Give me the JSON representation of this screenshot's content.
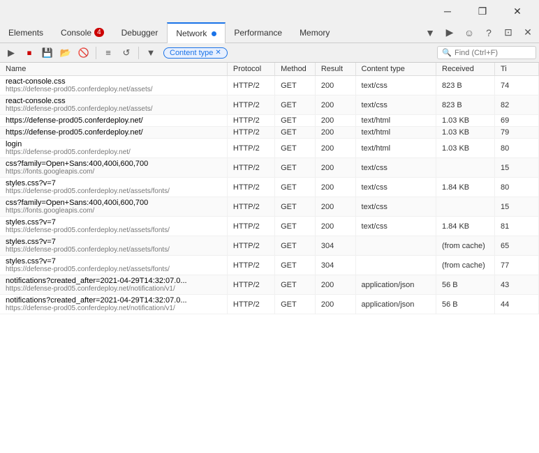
{
  "window": {
    "minimize_label": "─",
    "maximize_label": "❐",
    "close_label": "✕"
  },
  "top_toolbar": {
    "icons": [
      "⬚",
      "☆",
      "⊕",
      "✒",
      "⬆",
      "⋯"
    ]
  },
  "tabs": [
    {
      "id": "elements",
      "label": "Elements",
      "active": false,
      "badge": null,
      "dot": false
    },
    {
      "id": "console",
      "label": "Console",
      "active": false,
      "badge": "4",
      "dot": false
    },
    {
      "id": "debugger",
      "label": "Debugger",
      "active": false,
      "badge": null,
      "dot": false
    },
    {
      "id": "network",
      "label": "Network",
      "active": true,
      "badge": null,
      "dot": true
    },
    {
      "id": "performance",
      "label": "Performance",
      "active": false,
      "badge": null,
      "dot": false
    },
    {
      "id": "memory",
      "label": "Memory",
      "active": false,
      "badge": null,
      "dot": false
    }
  ],
  "tab_bar_right_icons": [
    "▼",
    "▶",
    "☺",
    "?",
    "⊡",
    "✕"
  ],
  "network_toolbar": {
    "buttons": [
      {
        "id": "record",
        "icon": "▶",
        "title": "Record",
        "active": false
      },
      {
        "id": "stop",
        "icon": "⏹",
        "title": "Stop",
        "active": true
      },
      {
        "id": "save",
        "icon": "💾",
        "title": "Save",
        "active": false
      },
      {
        "id": "import",
        "icon": "📥",
        "title": "Import",
        "active": false
      },
      {
        "id": "clear",
        "icon": "🚫",
        "title": "Clear",
        "active": false
      },
      {
        "id": "filter-sep",
        "icon": "sep"
      },
      {
        "id": "har",
        "icon": "📄",
        "title": "HAR",
        "active": false
      },
      {
        "id": "reload",
        "icon": "↺",
        "title": "Reload",
        "active": false
      },
      {
        "id": "filter-sep2",
        "icon": "sep"
      },
      {
        "id": "filter",
        "icon": "▼",
        "title": "Filter",
        "active": false
      }
    ],
    "filter_chip_label": "Content type",
    "search_placeholder": "Find (Ctrl+F)"
  },
  "table": {
    "columns": [
      {
        "id": "name",
        "label": "Name"
      },
      {
        "id": "protocol",
        "label": "Protocol"
      },
      {
        "id": "method",
        "label": "Method"
      },
      {
        "id": "result",
        "label": "Result"
      },
      {
        "id": "content_type",
        "label": "Content type"
      },
      {
        "id": "received",
        "label": "Received"
      },
      {
        "id": "time",
        "label": "Ti"
      }
    ],
    "rows": [
      {
        "name": "react-console.css",
        "url": "https://defense-prod05.conferdeploy.net/assets/",
        "protocol": "HTTP/2",
        "method": "GET",
        "result": "200",
        "content_type": "text/css",
        "received": "823 B",
        "time": "74"
      },
      {
        "name": "react-console.css",
        "url": "https://defense-prod05.conferdeploy.net/assets/",
        "protocol": "HTTP/2",
        "method": "GET",
        "result": "200",
        "content_type": "text/css",
        "received": "823 B",
        "time": "82"
      },
      {
        "name": "https://defense-prod05.conferdeploy.net/",
        "url": "",
        "protocol": "HTTP/2",
        "method": "GET",
        "result": "200",
        "content_type": "text/html",
        "received": "1.03 KB",
        "time": "69"
      },
      {
        "name": "https://defense-prod05.conferdeploy.net/",
        "url": "",
        "protocol": "HTTP/2",
        "method": "GET",
        "result": "200",
        "content_type": "text/html",
        "received": "1.03 KB",
        "time": "79"
      },
      {
        "name": "login",
        "url": "https://defense-prod05.conferdeploy.net/",
        "protocol": "HTTP/2",
        "method": "GET",
        "result": "200",
        "content_type": "text/html",
        "received": "1.03 KB",
        "time": "80"
      },
      {
        "name": "css?family=Open+Sans:400,400i,600,700",
        "url": "https://fonts.googleapis.com/",
        "protocol": "HTTP/2",
        "method": "GET",
        "result": "200",
        "content_type": "text/css",
        "received": "",
        "time": "15"
      },
      {
        "name": "styles.css?v=7",
        "url": "https://defense-prod05.conferdeploy.net/assets/fonts/",
        "protocol": "HTTP/2",
        "method": "GET",
        "result": "200",
        "content_type": "text/css",
        "received": "1.84 KB",
        "time": "80"
      },
      {
        "name": "css?family=Open+Sans:400,400i,600,700",
        "url": "https://fonts.googleapis.com/",
        "protocol": "HTTP/2",
        "method": "GET",
        "result": "200",
        "content_type": "text/css",
        "received": "",
        "time": "15"
      },
      {
        "name": "styles.css?v=7",
        "url": "https://defense-prod05.conferdeploy.net/assets/fonts/",
        "protocol": "HTTP/2",
        "method": "GET",
        "result": "200",
        "content_type": "text/css",
        "received": "1.84 KB",
        "time": "81"
      },
      {
        "name": "styles.css?v=7",
        "url": "https://defense-prod05.conferdeploy.net/assets/fonts/",
        "protocol": "HTTP/2",
        "method": "GET",
        "result": "304",
        "content_type": "",
        "received": "(from cache)",
        "time": "65"
      },
      {
        "name": "styles.css?v=7",
        "url": "https://defense-prod05.conferdeploy.net/assets/fonts/",
        "protocol": "HTTP/2",
        "method": "GET",
        "result": "304",
        "content_type": "",
        "received": "(from cache)",
        "time": "77"
      },
      {
        "name": "notifications?created_after=2021-04-29T14:32:07.0...",
        "url": "https://defense-prod05.conferdeploy.net/notification/v1/",
        "protocol": "HTTP/2",
        "method": "GET",
        "result": "200",
        "content_type": "application/json",
        "received": "56 B",
        "time": "43"
      },
      {
        "name": "notifications?created_after=2021-04-29T14:32:07.0...",
        "url": "https://defense-prod05.conferdeploy.net/notification/v1/",
        "protocol": "HTTP/2",
        "method": "GET",
        "result": "200",
        "content_type": "application/json",
        "received": "56 B",
        "time": "44"
      }
    ]
  }
}
